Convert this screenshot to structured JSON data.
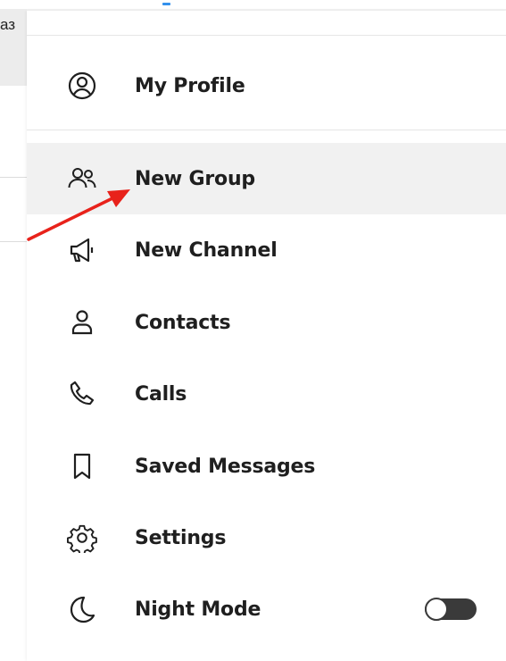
{
  "background": {
    "fragment_text": "аз"
  },
  "menu": {
    "items": [
      {
        "label": "My Profile",
        "icon": "user-circle-icon"
      },
      {
        "label": "New Group",
        "icon": "users-icon"
      },
      {
        "label": "New Channel",
        "icon": "megaphone-icon"
      },
      {
        "label": "Contacts",
        "icon": "user-icon"
      },
      {
        "label": "Calls",
        "icon": "phone-icon"
      },
      {
        "label": "Saved Messages",
        "icon": "bookmark-icon"
      },
      {
        "label": "Settings",
        "icon": "gear-icon"
      },
      {
        "label": "Night Mode",
        "icon": "moon-icon"
      }
    ],
    "night_mode_enabled": false
  },
  "colors": {
    "accent": "#3390ec",
    "annotation": "#e8221b",
    "highlight_bg": "#f1f1f1"
  }
}
